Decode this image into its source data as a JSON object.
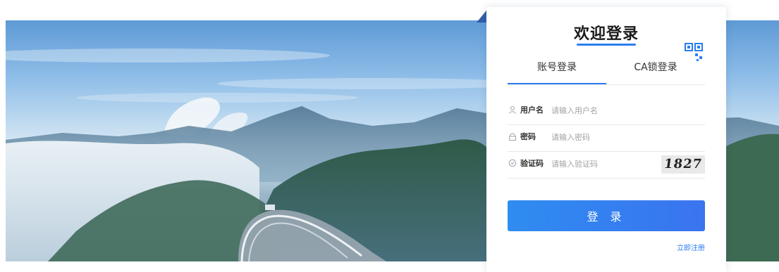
{
  "login": {
    "title": "欢迎登录",
    "tabs": [
      {
        "label": "账号登录",
        "active": true
      },
      {
        "label": "CA锁登录",
        "active": false
      }
    ],
    "fields": [
      {
        "icon": "user-icon",
        "label": "用户名",
        "placeholder": "请输入用户名",
        "value": ""
      },
      {
        "icon": "lock-icon",
        "label": "密码",
        "placeholder": "请输入密码",
        "value": ""
      },
      {
        "icon": "shield-check-icon",
        "label": "验证码",
        "placeholder": "请输入验证码",
        "value": ""
      }
    ],
    "captcha_text": "1827",
    "submit_label": "登 录",
    "register_link": "立即注册"
  },
  "qr_login_icon": "qr-code-icon",
  "colors": {
    "accent": "#2a7ef0",
    "button": "#3182f0",
    "banner_sky": "#8bbbe7"
  }
}
